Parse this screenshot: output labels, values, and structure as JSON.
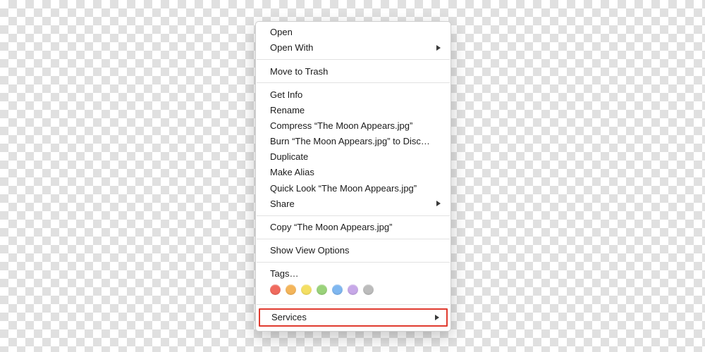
{
  "menu": {
    "open": "Open",
    "open_with": "Open With",
    "move_to_trash": "Move to Trash",
    "get_info": "Get Info",
    "rename": "Rename",
    "compress": "Compress “The Moon Appears.jpg”",
    "burn": "Burn “The Moon Appears.jpg” to Disc…",
    "duplicate": "Duplicate",
    "make_alias": "Make Alias",
    "quick_look": "Quick Look “The Moon Appears.jpg”",
    "share": "Share",
    "copy": "Copy “The Moon Appears.jpg”",
    "show_view_options": "Show View Options",
    "tags": "Tags…",
    "services": "Services"
  },
  "tag_colors": [
    "#f06a5e",
    "#f4b55a",
    "#f4df63",
    "#9ad27a",
    "#7fb7f0",
    "#c7a8e8",
    "#bcbcbc"
  ],
  "highlight_color": "#e03b2f"
}
